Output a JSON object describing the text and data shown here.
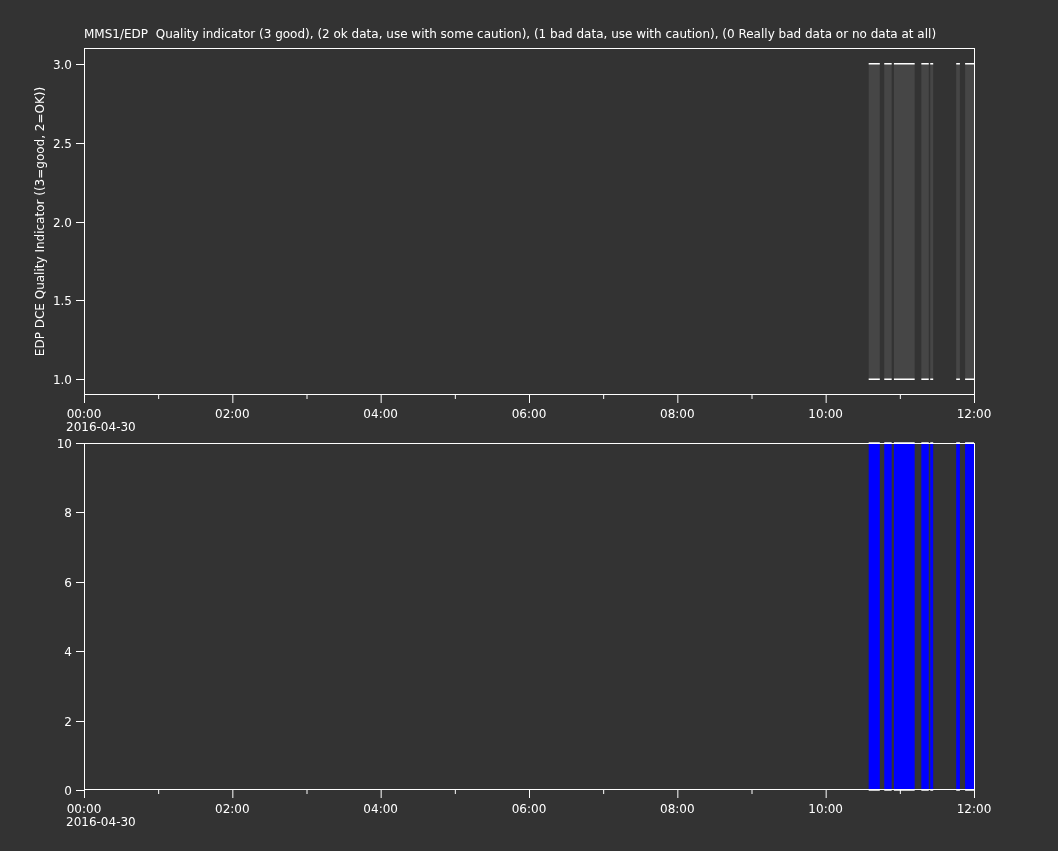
{
  "title": "MMS1/EDP  Quality indicator (3 good), (2 ok data, use with some caution), (1 bad data, use with caution), (0 Really bad data or no data at all)",
  "panels": [
    {
      "date_label": "2016-04-30",
      "chart_data": {
        "type": "area",
        "ylabel": "EDP DCE Quality Indicator ((3=good, 2=OK))",
        "xlim": [
          0,
          12
        ],
        "ylim": [
          0.9,
          3.1
        ],
        "xticks": [
          {
            "value": 0,
            "label": "00:00"
          },
          {
            "value": 2,
            "label": "02:00"
          },
          {
            "value": 4,
            "label": "04:00"
          },
          {
            "value": 6,
            "label": "06:00"
          },
          {
            "value": 8,
            "label": "08:00"
          },
          {
            "value": 10,
            "label": "10:00"
          },
          {
            "value": 12,
            "label": "12:00"
          }
        ],
        "yticks": [
          {
            "value": 1,
            "label": "1.0"
          },
          {
            "value": 1.5,
            "label": "1.5"
          },
          {
            "value": 2,
            "label": "2.0"
          },
          {
            "value": 2.5,
            "label": "2.5"
          },
          {
            "value": 3,
            "label": "3.0"
          }
        ],
        "x": [
          10.58,
          10.58,
          10.73,
          10.73,
          10.79,
          10.79,
          10.89,
          10.89,
          10.92,
          10.92,
          11.2,
          11.2,
          11.29,
          11.29,
          11.39,
          11.39,
          11.41,
          11.41,
          11.45,
          11.45,
          11.76,
          11.76,
          11.81,
          11.81,
          11.88,
          11.88,
          12
        ],
        "series": [
          {
            "color": "#464646",
            "values": [
              1,
              3,
              3,
              1,
              1,
              3,
              3,
              1,
              1,
              3,
              3,
              1,
              1,
              3,
              3,
              1,
              1,
              3,
              3,
              1,
              1,
              3,
              3,
              1,
              1,
              3,
              3
            ]
          }
        ]
      }
    },
    {
      "date_label": "2016-04-30",
      "chart_data": {
        "type": "area",
        "xlim": [
          0,
          12
        ],
        "ylim": [
          0,
          10
        ],
        "xticks": [
          {
            "value": 0,
            "label": "00:00"
          },
          {
            "value": 2,
            "label": "02:00"
          },
          {
            "value": 4,
            "label": "04:00"
          },
          {
            "value": 6,
            "label": "06:00"
          },
          {
            "value": 8,
            "label": "08:00"
          },
          {
            "value": 10,
            "label": "10:00"
          },
          {
            "value": 12,
            "label": "12:00"
          }
        ],
        "yticks": [
          0,
          2,
          4,
          6,
          8,
          10
        ],
        "x": [
          10.58,
          10.58,
          10.73,
          10.73,
          10.79,
          10.79,
          10.89,
          10.89,
          10.92,
          10.92,
          11.2,
          11.2,
          11.29,
          11.29,
          11.39,
          11.39,
          11.41,
          11.41,
          11.45,
          11.45,
          11.76,
          11.76,
          11.81,
          11.81,
          11.88,
          11.88,
          12
        ],
        "series": [
          {
            "color": "#0000ff",
            "values": [
              0,
              10,
              10,
              0,
              0,
              10,
              10,
              0,
              0,
              10,
              10,
              0,
              0,
              10,
              10,
              0,
              0,
              10,
              10,
              0,
              0,
              10,
              10,
              0,
              0,
              10,
              10
            ]
          }
        ]
      }
    }
  ]
}
